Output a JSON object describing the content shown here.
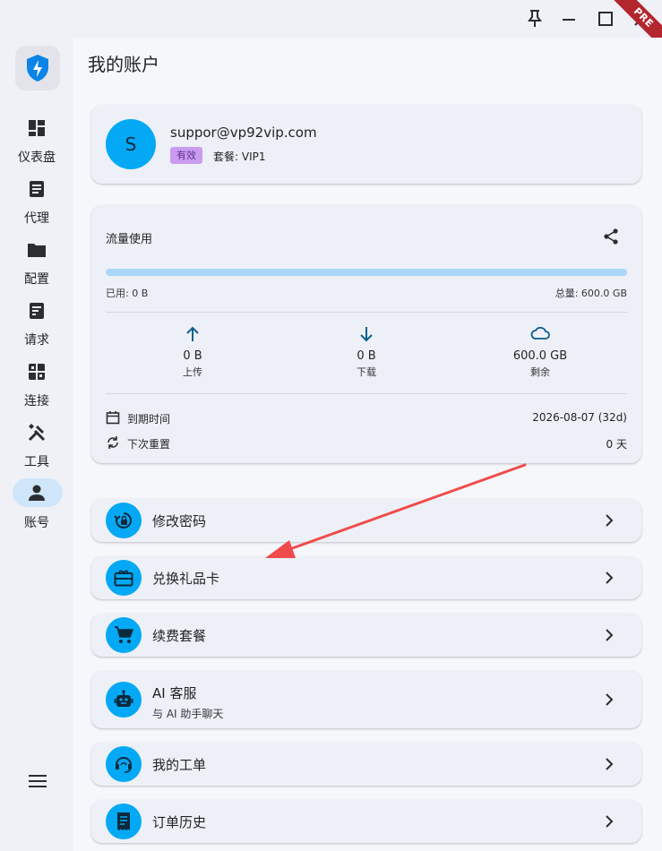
{
  "window": {
    "ribbon_text": "PRE",
    "controls": [
      "pin-icon",
      "minimize-icon",
      "maximize-icon",
      "close-icon"
    ]
  },
  "sidebar": {
    "items": [
      {
        "label": "仪表盘",
        "icon": "dashboard-icon"
      },
      {
        "label": "代理",
        "icon": "proxy-list-icon"
      },
      {
        "label": "配置",
        "icon": "folder-icon"
      },
      {
        "label": "请求",
        "icon": "requests-icon"
      },
      {
        "label": "连接",
        "icon": "connections-icon"
      },
      {
        "label": "工具",
        "icon": "tools-icon"
      },
      {
        "label": "账号",
        "icon": "account-icon",
        "active": true
      }
    ]
  },
  "page": {
    "title": "我的账户"
  },
  "account": {
    "avatar_letter": "S",
    "email": "suppor@vp92vip.com",
    "status_badge": "有效",
    "plan": "套餐: VIP1"
  },
  "traffic": {
    "title": "流量使用",
    "used_label": "已用: 0 B",
    "total_label": "总量: 600.0 GB",
    "used_fraction": 0,
    "upload": {
      "value": "0 B",
      "label": "上传"
    },
    "download": {
      "value": "0 B",
      "label": "下载"
    },
    "remaining": {
      "value": "600.0 GB",
      "label": "剩余"
    },
    "expiry": {
      "label": "到期时间",
      "value": "2026-08-07 (32d)"
    },
    "reset": {
      "label": "下次重置",
      "value": "0 天"
    }
  },
  "menu": [
    {
      "label": "修改密码",
      "icon": "lock-reset-icon"
    },
    {
      "label": "兑换礼品卡",
      "icon": "gift-card-icon"
    },
    {
      "label": "续费套餐",
      "icon": "cart-icon"
    },
    {
      "label": "AI 客服",
      "sublabel": "与 AI 助手聊天",
      "icon": "robot-icon"
    },
    {
      "label": "我的工单",
      "icon": "support-agent-icon"
    },
    {
      "label": "订单历史",
      "icon": "receipt-icon"
    }
  ],
  "colors": {
    "accent": "#03a9f4",
    "badge_bg": "#c99cf0",
    "nav_active": "#cfe6fa",
    "annotation_arrow": "#ef4b4b"
  }
}
